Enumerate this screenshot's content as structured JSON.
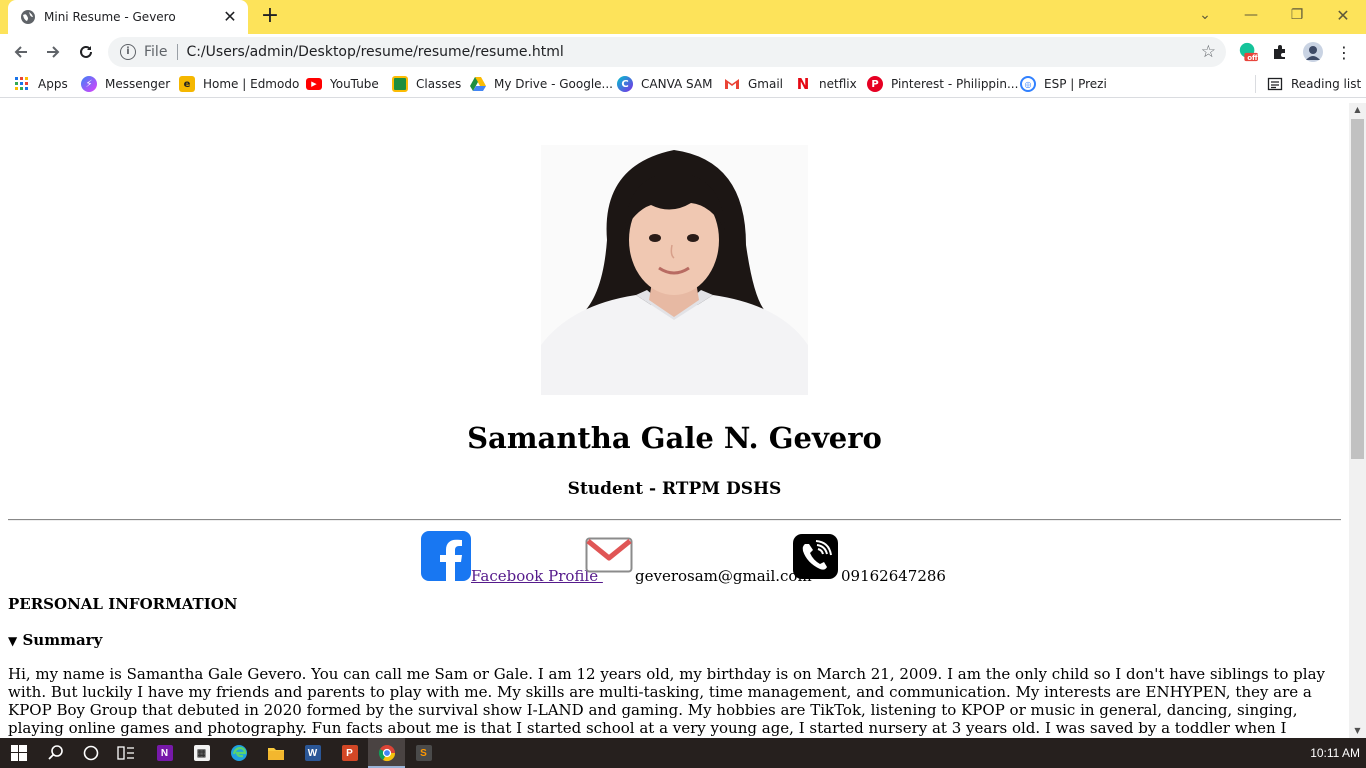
{
  "browser": {
    "tab_title": "Mini Resume - Gevero",
    "file_label": "File",
    "url": "C:/Users/admin/Desktop/resume/resume/resume.html",
    "extension_badge": "off",
    "accent_color": "#fde35a"
  },
  "bookmarks": [
    {
      "label": "Apps",
      "icon": "apps-grid-icon"
    },
    {
      "label": "Messenger",
      "icon": "messenger-icon"
    },
    {
      "label": "Home | Edmodo",
      "icon": "edmodo-icon"
    },
    {
      "label": "YouTube",
      "icon": "youtube-icon"
    },
    {
      "label": "Classes",
      "icon": "classroom-icon"
    },
    {
      "label": "My Drive - Google...",
      "icon": "drive-icon"
    },
    {
      "label": "CANVA SAM",
      "icon": "canva-icon"
    },
    {
      "label": "Gmail",
      "icon": "gmail-icon"
    },
    {
      "label": "netflix",
      "icon": "netflix-icon"
    },
    {
      "label": "Pinterest - Philippin...",
      "icon": "pinterest-icon"
    },
    {
      "label": "ESP | Prezi",
      "icon": "prezi-icon"
    }
  ],
  "reading_list": "Reading list",
  "resume": {
    "name": "Samantha Gale N. Gevero",
    "subtitle": "Student - RTPM DSHS",
    "facebook_label": "Facebook Profile ",
    "email": "geverosam@gmail.com",
    "phone": "09162647286",
    "section_title": "PERSONAL INFORMATION",
    "summary_label": "Summary",
    "summary_text": "Hi, my name is Samantha Gale Gevero. You can call me Sam or Gale. I am 12 years old, my birthday is on March 21, 2009. I am the only child so I don't have siblings to play with. But luckily I have my friends and parents to play with me. My skills are multi-tasking, time management, and communication. My interests are ENHYPEN, they are a KPOP Boy Group that debuted in 2020 formed by the survival show I-LAND and gaming. My hobbies are TikTok, listening to KPOP or music in general, dancing, singing, playing online games and photography. Fun facts about me is that I started school at a very young age, I started nursery at 3 years old. I was saved by a toddler when I drowned in the swimming pool because I forgot to wear my life jacket. My favorite fun fact is that both my names Samantha and Gale are"
  },
  "taskbar": {
    "clock": "10:11 AM"
  }
}
